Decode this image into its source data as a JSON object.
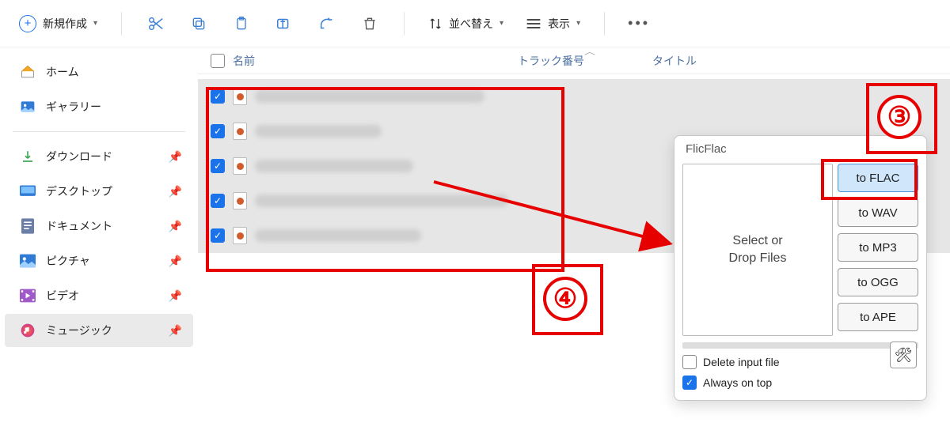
{
  "toolbar": {
    "new_label": "新規作成",
    "sort_label": "並べ替え",
    "view_label": "表示"
  },
  "sidebar": {
    "home_label": "ホーム",
    "gallery_label": "ギャラリー",
    "quick": [
      {
        "label": "ダウンロード"
      },
      {
        "label": "デスクトップ"
      },
      {
        "label": "ドキュメント"
      },
      {
        "label": "ピクチャ"
      },
      {
        "label": "ビデオ"
      },
      {
        "label": "ミュージック"
      }
    ]
  },
  "columns": {
    "name": "名前",
    "track": "トラック番号",
    "title": "タイトル"
  },
  "flicflac": {
    "title": "FlicFlac",
    "drop_line1": "Select or",
    "drop_line2": "Drop Files",
    "buttons": {
      "flac": "to FLAC",
      "wav": "to WAV",
      "mp3": "to MP3",
      "ogg": "to OGG",
      "ape": "to APE"
    },
    "delete_label": "Delete input file",
    "ontop_label": "Always on top",
    "delete_checked": false,
    "ontop_checked": true
  },
  "annotations": {
    "step3": "③",
    "step4": "④"
  }
}
